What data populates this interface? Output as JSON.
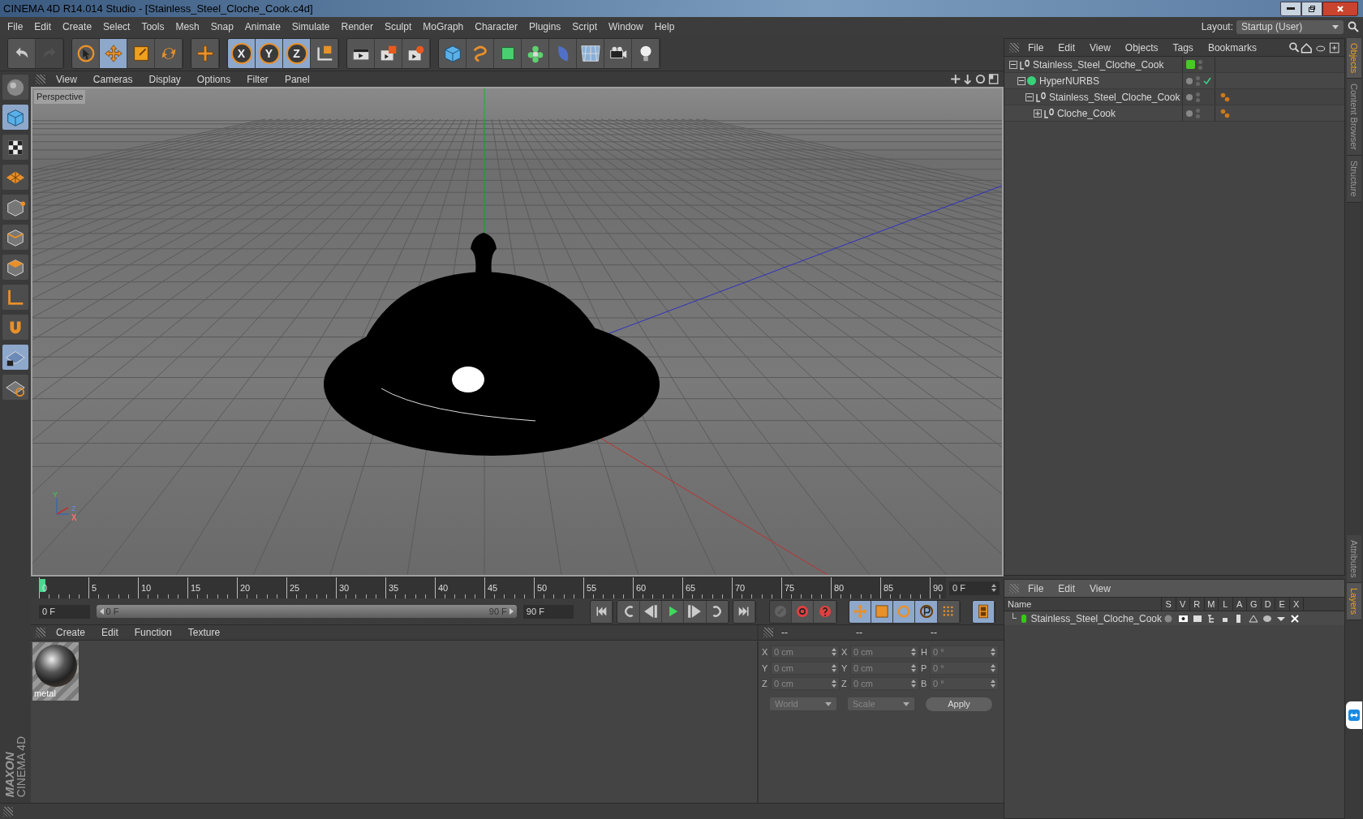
{
  "window": {
    "title": "CINEMA 4D R14.014 Studio - [Stainless_Steel_Cloche_Cook.c4d]"
  },
  "menu": [
    "File",
    "Edit",
    "Create",
    "Select",
    "Tools",
    "Mesh",
    "Snap",
    "Animate",
    "Simulate",
    "Render",
    "Sculpt",
    "MoGraph",
    "Character",
    "Plugins",
    "Script",
    "Window",
    "Help"
  ],
  "layout": {
    "label": "Layout:",
    "value": "Startup (User)"
  },
  "toolbar": [
    [
      {
        "kind": "undo",
        "selected": false,
        "disabled": false
      },
      {
        "kind": "redo",
        "selected": false,
        "disabled": true
      }
    ],
    [
      {
        "kind": "select",
        "selected": false
      },
      {
        "kind": "move",
        "selected": true
      },
      {
        "kind": "scale",
        "selected": false
      },
      {
        "kind": "rotate",
        "selected": false
      }
    ],
    [
      {
        "kind": "add",
        "selected": false
      }
    ],
    [
      {
        "kind": "x",
        "selected": true,
        "label": "X"
      },
      {
        "kind": "y",
        "selected": true,
        "label": "Y"
      },
      {
        "kind": "z",
        "selected": true,
        "label": "Z"
      },
      {
        "kind": "coords",
        "selected": false
      }
    ],
    [
      {
        "kind": "render-view",
        "selected": false
      },
      {
        "kind": "render",
        "selected": false
      },
      {
        "kind": "render-settings",
        "selected": false
      }
    ],
    [
      {
        "kind": "cube",
        "selected": false
      },
      {
        "kind": "spline",
        "selected": false
      },
      {
        "kind": "nurbs",
        "selected": false
      },
      {
        "kind": "array",
        "selected": false
      },
      {
        "kind": "deformer",
        "selected": false
      },
      {
        "kind": "floor",
        "selected": false
      },
      {
        "kind": "camera",
        "selected": false
      },
      {
        "kind": "light",
        "selected": false
      }
    ]
  ],
  "left_toolbar": [
    {
      "kind": "sphere",
      "selected": false
    },
    {
      "kind": "cube",
      "selected": true
    },
    {
      "kind": "checker",
      "selected": false
    },
    {
      "kind": "plane",
      "selected": false
    },
    {
      "kind": "points",
      "selected": false
    },
    {
      "kind": "edges",
      "selected": false
    },
    {
      "kind": "polygons",
      "selected": false
    },
    {
      "kind": "axis",
      "selected": false
    },
    {
      "kind": "magnet",
      "selected": false
    },
    {
      "kind": "grid-lock",
      "selected": true
    },
    {
      "kind": "grid-snap",
      "selected": false
    }
  ],
  "viewport": {
    "menu": [
      "View",
      "Cameras",
      "Display",
      "Options",
      "Filter",
      "Panel"
    ],
    "label": "Perspective",
    "gizmo": [
      "Y",
      "Z",
      "X"
    ]
  },
  "timeline": {
    "ticks": [
      "0",
      "5",
      "10",
      "15",
      "20",
      "25",
      "30",
      "35",
      "40",
      "45",
      "50",
      "55",
      "60",
      "65",
      "70",
      "75",
      "80",
      "85",
      "90"
    ],
    "frame": "0 F",
    "playhead": {
      "level": 0
    },
    "start": "0 F",
    "range": {
      "start": "0 F",
      "end": "90 F",
      "level": 1
    },
    "end": "90 F"
  },
  "playback": [
    {
      "kind": "first",
      "selected": false
    },
    {
      "kind": "loop-back",
      "selected": false
    },
    {
      "kind": "step-back",
      "selected": false
    },
    {
      "kind": "play",
      "selected": false
    },
    {
      "kind": "step-forward",
      "selected": false
    },
    {
      "kind": "loop",
      "selected": false
    },
    {
      "kind": "last",
      "selected": false
    }
  ],
  "keys": [
    {
      "kind": "autokey",
      "selected": false,
      "disabled": true
    },
    {
      "kind": "record",
      "selected": false
    },
    {
      "kind": "help",
      "selected": false
    },
    {
      "kind": "key-move",
      "selected": true
    },
    {
      "kind": "key-scale",
      "selected": true
    },
    {
      "kind": "key-rotate",
      "selected": true
    },
    {
      "kind": "key-param",
      "selected": true
    },
    {
      "kind": "key-points",
      "selected": false
    },
    {
      "kind": "film",
      "selected": true
    }
  ],
  "materials": {
    "menu": [
      "Create",
      "Edit",
      "Function",
      "Texture"
    ],
    "items": [
      {
        "name": "metal"
      }
    ]
  },
  "coordinates": {
    "headers": [
      "--",
      "--",
      "--"
    ],
    "rows": [
      [
        {
          "label": "X",
          "value": "0 cm"
        },
        {
          "label": "X",
          "value": "0 cm"
        },
        {
          "label": "H",
          "value": "0 °"
        }
      ],
      [
        {
          "label": "Y",
          "value": "0 cm"
        },
        {
          "label": "Y",
          "value": "0 cm"
        },
        {
          "label": "P",
          "value": "0 °"
        }
      ],
      [
        {
          "label": "Z",
          "value": "0 cm"
        },
        {
          "label": "Z",
          "value": "0 cm"
        },
        {
          "label": "B",
          "value": "0 °"
        }
      ]
    ],
    "space": "World",
    "mode": "Scale",
    "apply": "Apply"
  },
  "objects": {
    "menu": [
      "File",
      "Edit",
      "View",
      "Objects",
      "Tags",
      "Bookmarks"
    ],
    "tree": [
      {
        "name": "Stainless_Steel_Cloche_Cook",
        "kind": "null",
        "expanded": true,
        "color": "#44cc22",
        "tag": false,
        "checked": false,
        "children": [
          {
            "name": "HyperNURBS",
            "kind": "nurbs",
            "expanded": true,
            "tag": false,
            "checked": true,
            "children": [
              {
                "name": "Stainless_Steel_Cloche_Cook",
                "kind": "null",
                "expanded": true,
                "tag": true,
                "checked": false,
                "children": [
                  {
                    "name": "Cloche_Cook",
                    "kind": "null",
                    "expanded": false,
                    "tag": true,
                    "checked": false
                  }
                ]
              }
            ]
          }
        ]
      }
    ]
  },
  "side_tabs_top": [
    {
      "label": "Objects",
      "selected": true
    },
    {
      "label": "Content Browser",
      "selected": false
    },
    {
      "label": "Structure",
      "selected": false
    }
  ],
  "layers": {
    "menu": [
      "File",
      "Edit",
      "View"
    ],
    "columns": [
      "Name",
      "S",
      "V",
      "R",
      "M",
      "L",
      "A",
      "G",
      "D",
      "E",
      "X"
    ],
    "rows": [
      {
        "name": "Stainless_Steel_Cloche_Cook",
        "color": "#33cc11"
      }
    ]
  },
  "side_tabs_bottom": [
    {
      "label": "Attributes",
      "selected": false
    },
    {
      "label": "Layers",
      "selected": true
    }
  ],
  "logo": {
    "brand": "MAXON",
    "product": "CINEMA 4D"
  }
}
